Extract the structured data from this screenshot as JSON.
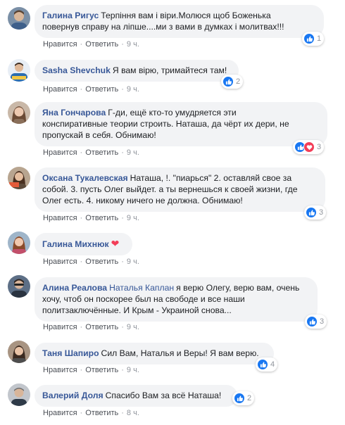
{
  "colors": {
    "author": "#385898",
    "bubble": "#f2f3f5",
    "meta": "#90949c",
    "like": "#1877f2",
    "love": "#f33e58"
  },
  "icons": {
    "like": "thumbs-up-icon",
    "love": "heart-icon",
    "inline_heart": "heart-emoji-icon"
  },
  "actions": {
    "like_label": "Нравится",
    "reply_label": "Ответить",
    "separator": "·"
  },
  "comments": [
    {
      "author": "Галина Ригус",
      "line1": "Терпіння вам і віри.Молюся щоб Боженька",
      "line2": "повернув справу на ліпше....ми з вами в думках і молитвах!!!",
      "time": "9 ч.",
      "reactions": [
        "like"
      ],
      "count": "1"
    },
    {
      "author": "Sasha Shevchuk",
      "line1": "Я вам вірю, тримайтеся там!",
      "time": "9 ч.",
      "reactions": [
        "like"
      ],
      "count": "2"
    },
    {
      "author": "Яна Гончарова",
      "line1": "Г-ди, ещё кто-то умудряется эти",
      "line2": "конспиративные теории строить. Наташа, да чёрт их дери, не",
      "line3": "пропускай в себя. Обнимаю!",
      "time": "9 ч.",
      "reactions": [
        "like",
        "love"
      ],
      "count": "3"
    },
    {
      "author": "Оксана Тукалевская",
      "line1": "Наташа, !. \"пиарься\" 2. оставляй свое за",
      "line2": "собой. 3. пусть Олег выйдет. а ты вернешься к своей жизни, где",
      "line3": "Олег есть. 4. никому ничего не должна. Обнимаю!",
      "time": "9 ч.",
      "reactions": [
        "like"
      ],
      "count": "3"
    },
    {
      "author": "Галина Михнюк",
      "line1": "",
      "time": "9 ч."
    },
    {
      "author": "Алина Реалова",
      "tag": "Наталья Каплан",
      "line1": "я верю Олегу, верю вам, очень",
      "line2": "хочу, чтоб он поскорее был на свободе и все наши",
      "line3": "политзаключённые. И Крым - Украиной снова...",
      "time": "9 ч.",
      "reactions": [
        "like"
      ],
      "count": "3"
    },
    {
      "author": "Таня Шапиро",
      "line1": "Сил Вам, Наталья и Веры! Я вам верю.",
      "time": "9 ч.",
      "reactions": [
        "like"
      ],
      "count": "4"
    },
    {
      "author": "Валерий Доля",
      "line1": "Спасибо Вам за всё Наташа!",
      "time": "8 ч.",
      "reactions": [
        "like"
      ],
      "count": "2"
    }
  ]
}
